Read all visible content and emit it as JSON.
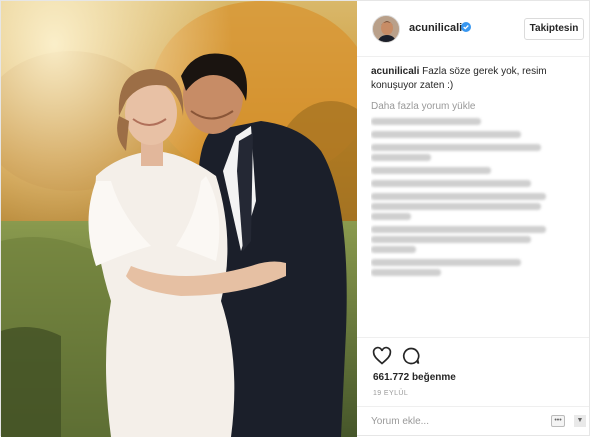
{
  "header": {
    "username": "acunilicali",
    "follow_label": "Takiptesin"
  },
  "caption": {
    "username": "acunilicali",
    "text": "Fazla söze gerek yok, resim konuşuyor zaten :)"
  },
  "load_more_label": "Daha fazla yorum yükle",
  "actions": {
    "likes_count": "661.772",
    "likes_label": "beğenme",
    "date": "19 EYLÜL"
  },
  "comment_input": {
    "placeholder": "Yorum ekle..."
  },
  "icons": {
    "verified": "verified-badge-icon",
    "like": "heart-icon",
    "comment": "comment-bubble-icon",
    "more": "more-options-icon"
  },
  "colors": {
    "verified_blue": "#3897f0",
    "text": "#262626",
    "muted": "#999999",
    "border": "#efefef"
  }
}
